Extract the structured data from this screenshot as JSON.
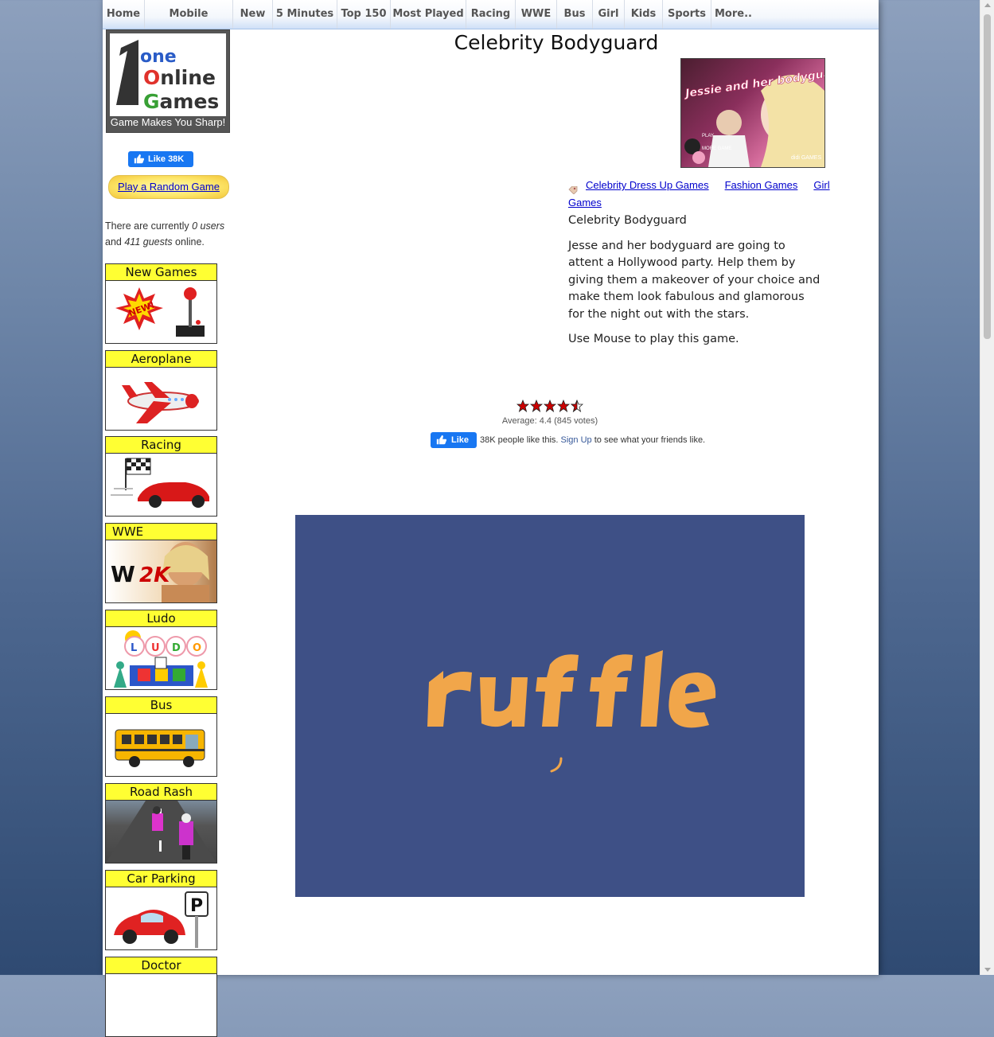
{
  "nav": {
    "items": [
      "Home",
      "Mobile Friendly",
      "New",
      "5 Minutes",
      "Top 150",
      "Most Played",
      "Racing",
      "WWE",
      "Bus",
      "Girl",
      "Kids",
      "Sports",
      "More.."
    ]
  },
  "sidebar": {
    "logo_text": [
      "one",
      "Online",
      "Games"
    ],
    "logo_tagline": "Game Makes You Sharp!",
    "fb_like_label": "Like 38K",
    "random_button": "Play a Random Game",
    "online": {
      "prefix": "There are currently ",
      "users": "0 users",
      "middle": " and ",
      "guests": "411 guests",
      "suffix": " online."
    },
    "categories": [
      "New Games",
      "Aeroplane",
      "Racing",
      "WWE",
      "Ludo",
      "Bus",
      "Road Rash",
      "Car Parking",
      "Doctor"
    ],
    "new_badge": "NEW!",
    "wwe_badge": "2K",
    "ludo_letters": [
      "L",
      "U",
      "D",
      "O"
    ],
    "parking_sign": "P"
  },
  "game": {
    "title": "Celebrity Bodyguard",
    "thumb_text": "Jessie and her bodyguard",
    "thumb_play": "PLAY",
    "thumb_more": "MORE GAME",
    "thumb_brand": "didi GAMES",
    "categories": [
      "Celebrity Dress Up Games",
      "Fashion Games",
      "Girl Games"
    ],
    "subtitle": "Celebrity Bodyguard",
    "description": "Jesse and her bodyguard are going to attent a Hollywood party. Help them by giving them a makeover of your choice and make them look fabulous and glamorous for the night out with the stars.",
    "controls": "Use Mouse to play this game."
  },
  "rating": {
    "stars": 4.4,
    "average_text": "Average: 4.4 (845 votes)"
  },
  "facebook": {
    "like_button": "Like",
    "text_before": "38K people like this. ",
    "signup_link": "Sign Up",
    "text_after": " to see what your friends like."
  },
  "player": {
    "logo_text": "ruffle",
    "background": "#3e5086",
    "logo_color": "#f1a64a"
  }
}
